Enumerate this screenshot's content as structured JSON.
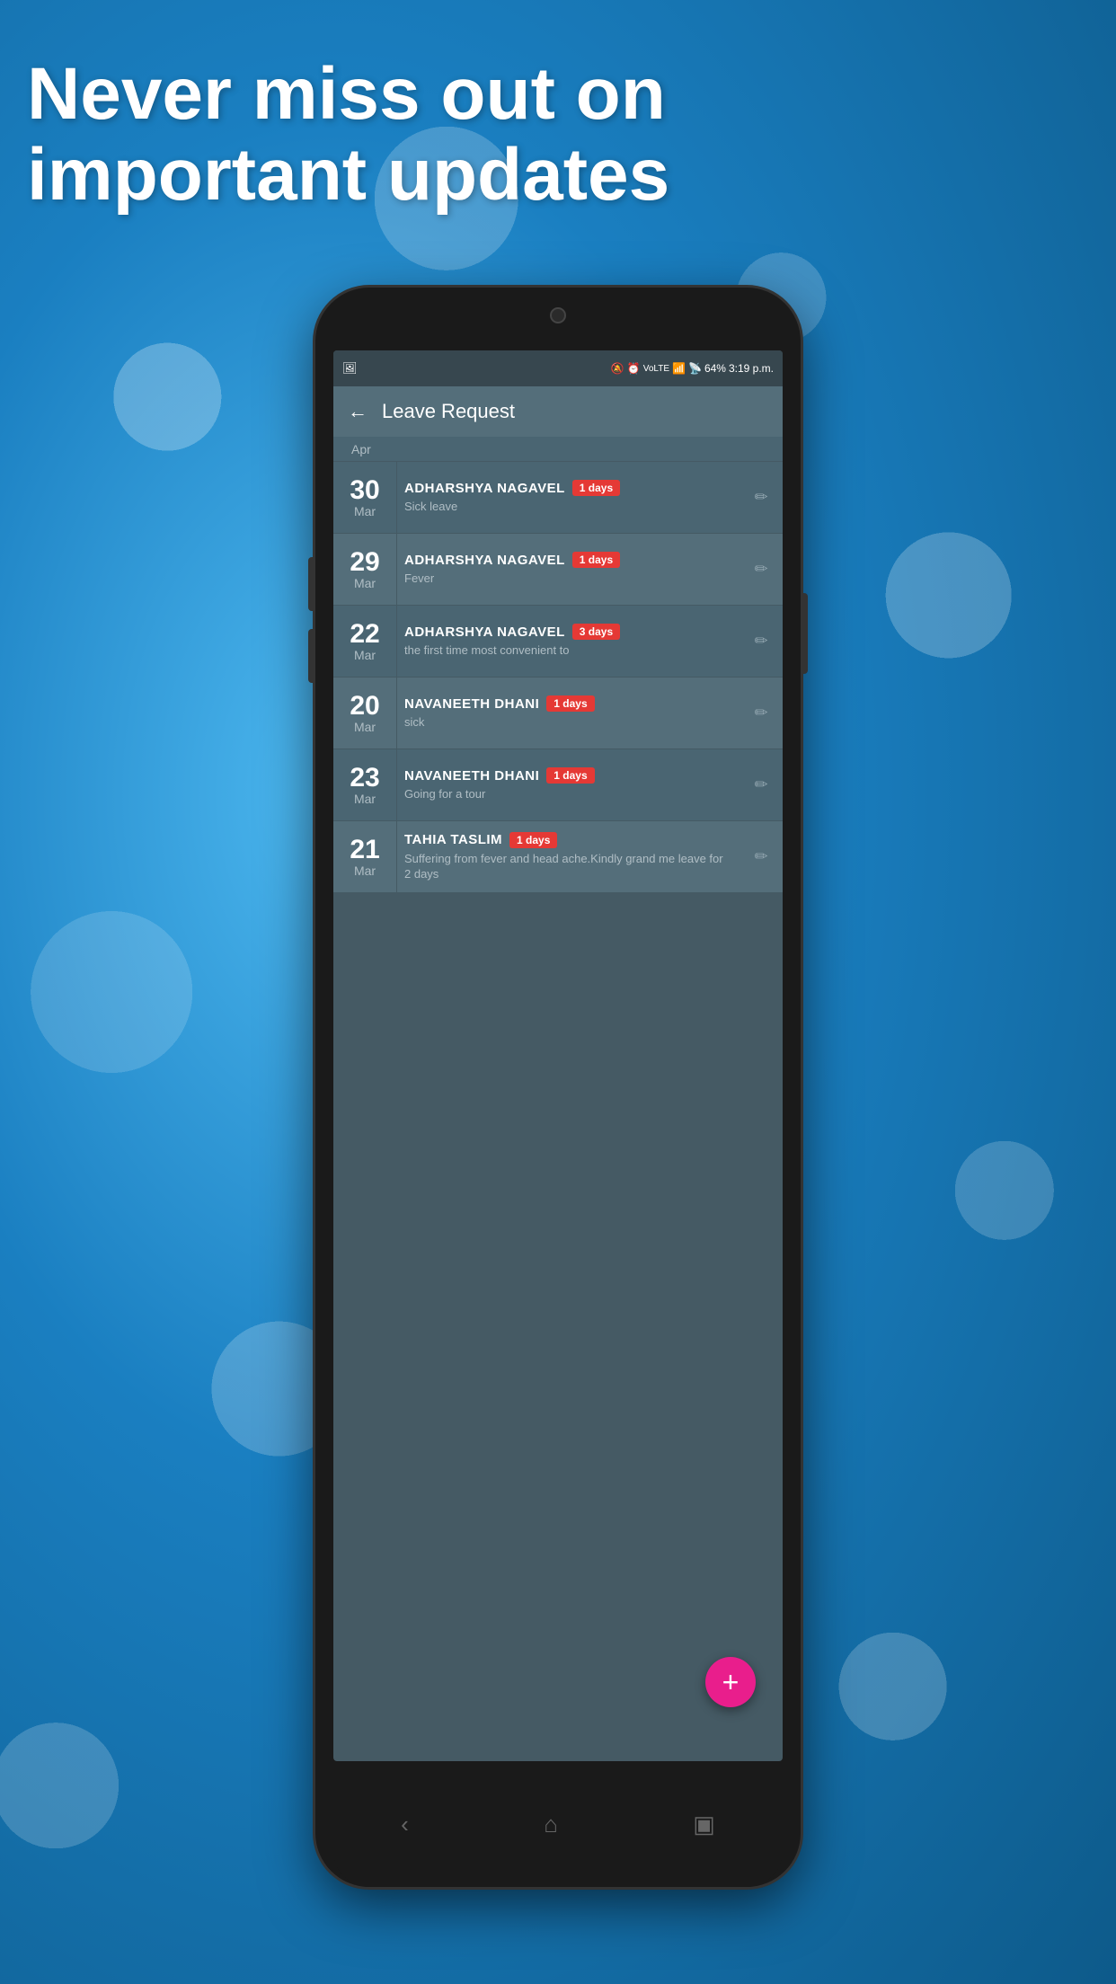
{
  "headline": {
    "line1": "Never miss out on",
    "line2": "important updates"
  },
  "status_bar": {
    "battery": "64%",
    "time": "3:19 p.m.",
    "signal_icon": "signal-icon",
    "wifi_icon": "wifi-icon",
    "battery_icon": "battery-icon"
  },
  "app_bar": {
    "title": "Leave Request",
    "back_label": "←"
  },
  "list_items": [
    {
      "day": "30",
      "month": "Mar",
      "name": "ADHARSHYA  NAGAVEL",
      "days": "1 days",
      "reason": "Sick leave"
    },
    {
      "day": "29",
      "month": "Mar",
      "name": "ADHARSHYA  NAGAVEL",
      "days": "1 days",
      "reason": "Fever"
    },
    {
      "day": "22",
      "month": "Mar",
      "name": "ADHARSHYA  NAGAVEL",
      "days": "3 days",
      "reason": "the first time most convenient to"
    },
    {
      "day": "20",
      "month": "Mar",
      "name": "NAVANEETH DHANI",
      "days": "1 days",
      "reason": "sick"
    },
    {
      "day": "23",
      "month": "Mar",
      "name": "NAVANEETH DHANI",
      "days": "1 days",
      "reason": "Going for a tour"
    },
    {
      "day": "21",
      "month": "Mar",
      "name": "TAHIA TASLIM",
      "days": "1 days",
      "reason": "Suffering from fever and head ache.Kindly grand me leave for 2 days"
    }
  ],
  "fab": {
    "label": "+",
    "color": "#e91e8c"
  },
  "nav": {
    "back": "‹",
    "home": "⌂",
    "recents": "▣"
  }
}
